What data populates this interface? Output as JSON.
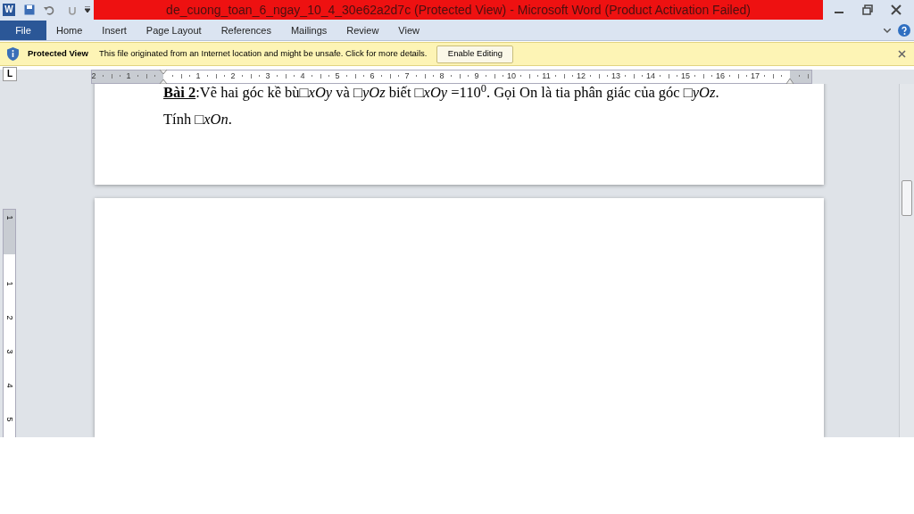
{
  "window": {
    "title": "de_cuong_toan_6_ngay_10_4_30e62a2d7c (Protected View)  -  Microsoft Word (Product Activation Failed)",
    "app_letter": "W"
  },
  "ribbon": {
    "file_tab": "File",
    "tabs": [
      "Home",
      "Insert",
      "Page Layout",
      "References",
      "Mailings",
      "Review",
      "View"
    ]
  },
  "protected_bar": {
    "title": "Protected View",
    "message": "This file originated from an Internet location and might be unsafe. Click for more details.",
    "button": "Enable Editing"
  },
  "ruler": {
    "tab_selector": "L",
    "left_labels": [
      "2",
      "1"
    ],
    "labels": [
      "1",
      "2",
      "3",
      "4",
      "5",
      "6",
      "7",
      "8",
      "9",
      "10",
      "11",
      "12",
      "13",
      "14",
      "15",
      "16",
      "17"
    ],
    "vertical_labels": [
      "1",
      "1",
      "2",
      "3",
      "4",
      "5"
    ]
  },
  "document": {
    "problem_label": "Bài 2",
    "problem_text": ":Vẽ hai góc kề bù□*xOy*  và  □*yOz*  biết  □*xOy* =110$^{0}$. Gọi On là tia phân giác của góc  □*yOz*.",
    "question": "Tính  □*xOn*."
  }
}
